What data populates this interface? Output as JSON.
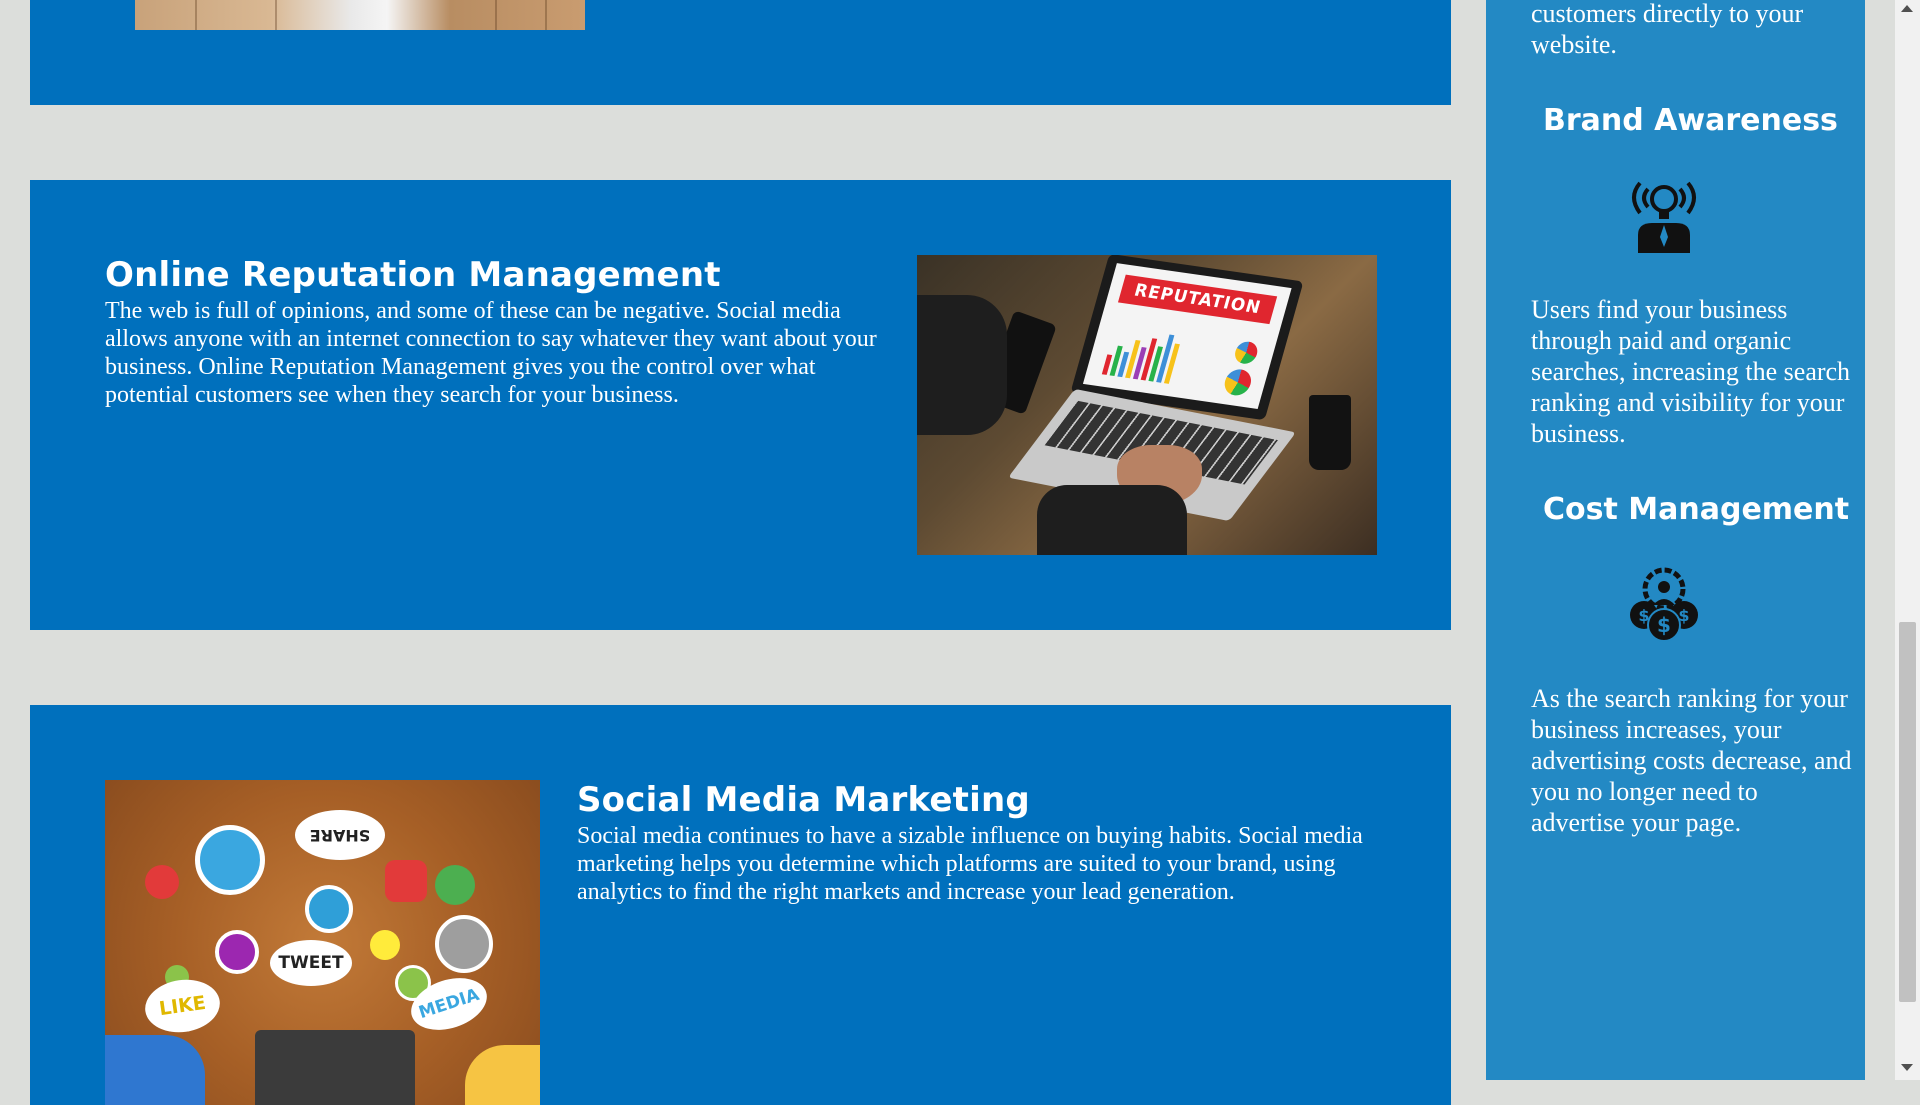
{
  "colors": {
    "page_background": "#dcdedb",
    "panel_blue": "#0070bd",
    "sidebar_blue": "#2389c4",
    "text": "#ffffff"
  },
  "services": {
    "reputation": {
      "title": "Online Reputation Management",
      "text": "The web is full of opinions, and some of these can be negative. Social media allows anyone with an internet connection to say whatever they want about your business. Online Reputation Management gives you the control over what potential customers see when they search for your business.",
      "image_caption": "REPUTATION"
    },
    "social": {
      "title": "Social Media Marketing",
      "text": "Social media continues to have a sizable influence on buying habits. Social media marketing helps you determine which platforms are suited to your brand, using analytics to find the right markets and increase your lead generation.",
      "image_tags": [
        "SHARE",
        "TWEET",
        "LIKE",
        "MEDIA"
      ]
    }
  },
  "sidebar": {
    "intro_tail": "customers directly to your website.",
    "benefits": [
      {
        "title": "Brand Awareness",
        "icon": "lightbulb-person-icon",
        "text": "Users find your business through paid and organic searches, increasing the search ranking and visibility for your business."
      },
      {
        "title": "Cost Management",
        "icon": "money-gear-icon",
        "text": "As the search ranking for your business increases, your advertising costs decrease, and you no longer need to advertise your page."
      }
    ]
  },
  "scrollbar": {
    "position": 0.72
  }
}
